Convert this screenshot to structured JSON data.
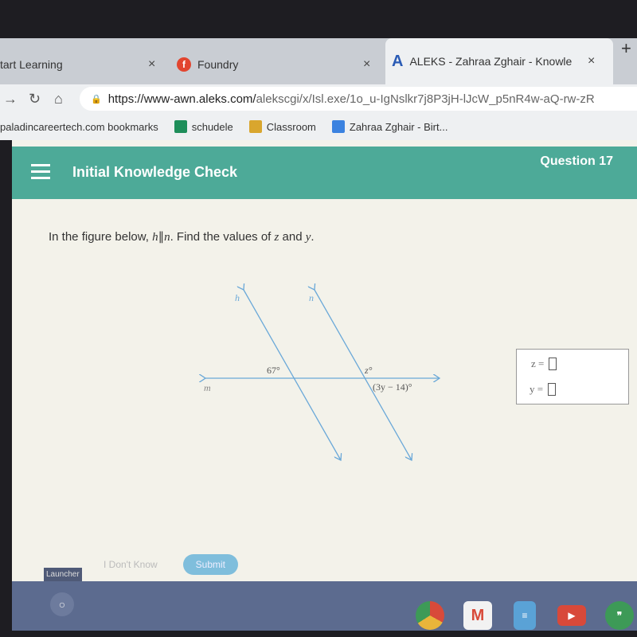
{
  "browser": {
    "tabs": [
      {
        "label": "tart Learning",
        "close": "×"
      },
      {
        "label": "Foundry",
        "close": "×",
        "favicon": "f"
      },
      {
        "label": "ALEKS - Zahraa Zghair - Knowle",
        "close": "×",
        "favicon": "A"
      }
    ],
    "new_tab": "+",
    "url_host": "https://www-awn.aleks.com/",
    "url_path": "alekscgi/x/Isl.exe/1o_u-IgNslkr7j8P3jH-lJcW_p5nR4w-aQ-rw-zR",
    "bookmarks": [
      {
        "label": "paladincareertech.com bookmarks"
      },
      {
        "label": "schudele",
        "color": "#1e8e5a"
      },
      {
        "label": "Classroom",
        "color": "#d9a62e"
      },
      {
        "label": "Zahraa Zghair - Birt...",
        "color": "#3b82e0"
      }
    ]
  },
  "header": {
    "title": "Initial Knowledge Check",
    "question": "Question 17",
    "color": "#4daa98"
  },
  "question": {
    "prefix": "In the figure below, ",
    "h": "h",
    "par": "∥",
    "n": "n",
    "suffix": ". Find the values of ",
    "z": "z",
    "and": " and ",
    "y": "y",
    "end": "."
  },
  "figure": {
    "line_h": "h",
    "line_n": "n",
    "line_m": "m",
    "angle1": "67°",
    "angle2": "z°",
    "angle3": "(3y − 14)°"
  },
  "answers": {
    "z_label": "z =",
    "y_label": "y ="
  },
  "buttons": {
    "dont_know": "I Don't Know",
    "submit": "Submit"
  },
  "shelf": {
    "launcher": "Launcher",
    "apps": [
      "chrome",
      "gmail",
      "docs",
      "youtube",
      "hangouts"
    ]
  }
}
